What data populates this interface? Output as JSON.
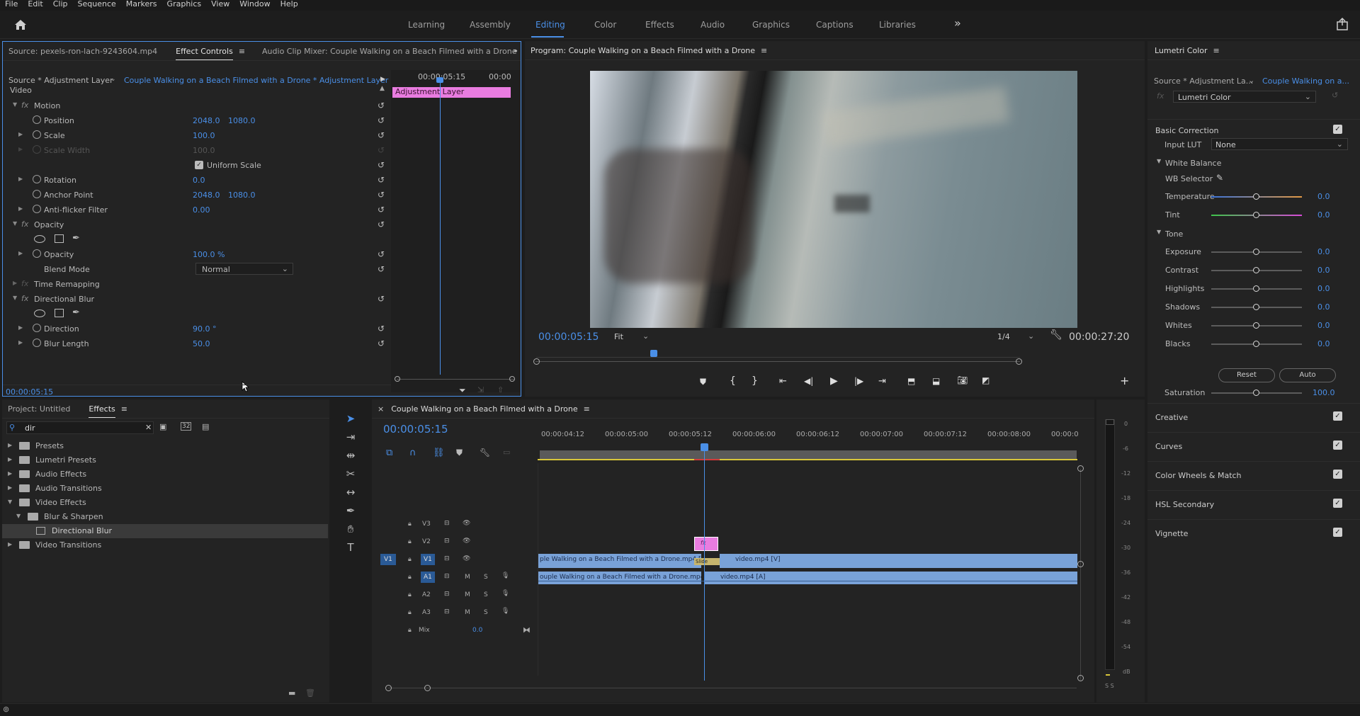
{
  "menu": [
    "File",
    "Edit",
    "Clip",
    "Sequence",
    "Markers",
    "Graphics",
    "View",
    "Window",
    "Help"
  ],
  "workspaces": {
    "tabs": [
      "Learning",
      "Assembly",
      "Editing",
      "Color",
      "Effects",
      "Audio",
      "Graphics",
      "Captions",
      "Libraries"
    ],
    "active": "Editing",
    "more": "»"
  },
  "effect_controls": {
    "tabs": [
      "Source: pexels-ron-lach-9243604.mp4",
      "Effect Controls",
      "Audio Clip Mixer: Couple Walking on a Beach Filmed with a Drone"
    ],
    "more": "»",
    "source_label": "Source * Adjustment Layer",
    "sequence_label": "Couple Walking on a Beach Filmed with a Drone * Adjustment Layer",
    "mini_tl_start": "00:00:05:15",
    "mini_tl_end": "00:00",
    "mini_clip": "Adjustment Layer",
    "section": "Video",
    "motion": "Motion",
    "position_label": "Position",
    "position_x": "2048.0",
    "position_y": "1080.0",
    "scale_label": "Scale",
    "scale_val": "100.0",
    "scalewidth_label": "Scale Width",
    "scalewidth_val": "100.0",
    "uniform_label": "Uniform Scale",
    "rotation_label": "Rotation",
    "rotation_val": "0.0",
    "anchor_label": "Anchor Point",
    "anchor_x": "2048.0",
    "anchor_y": "1080.0",
    "antiflicker_label": "Anti-flicker Filter",
    "antiflicker_val": "0.00",
    "opacity_group": "Opacity",
    "opacity_label": "Opacity",
    "opacity_val": "100.0 %",
    "blend_label": "Blend Mode",
    "blend_val": "Normal",
    "timeremap": "Time Remapping",
    "dirblur": "Directional Blur",
    "direction_label": "Direction",
    "direction_val": "90.0 °",
    "blurlen_label": "Blur Length",
    "blurlen_val": "50.0",
    "timecode": "00:00:05:15"
  },
  "program": {
    "title": "Program: Couple Walking on a Beach Filmed with a Drone",
    "timecode": "00:00:05:15",
    "fit": "Fit",
    "resolution": "1/4",
    "duration": "00:00:27:20"
  },
  "lumetri": {
    "title": "Lumetri Color",
    "source": "Source * Adjustment La...",
    "sequence": "Couple Walking on a...",
    "effect": "Lumetri Color",
    "basic": "Basic Correction",
    "input_lut_label": "Input LUT",
    "input_lut_val": "None",
    "white_balance": "White Balance",
    "wb_selector": "WB Selector",
    "temperature": {
      "label": "Temperature",
      "val": "0.0"
    },
    "tint": {
      "label": "Tint",
      "val": "0.0"
    },
    "tone": "Tone",
    "exposure": {
      "label": "Exposure",
      "val": "0.0"
    },
    "contrast": {
      "label": "Contrast",
      "val": "0.0"
    },
    "highlights": {
      "label": "Highlights",
      "val": "0.0"
    },
    "shadows": {
      "label": "Shadows",
      "val": "0.0"
    },
    "whites": {
      "label": "Whites",
      "val": "0.0"
    },
    "blacks": {
      "label": "Blacks",
      "val": "0.0"
    },
    "reset": "Reset",
    "auto": "Auto",
    "saturation": {
      "label": "Saturation",
      "val": "100.0"
    },
    "sections": [
      "Creative",
      "Curves",
      "Color Wheels & Match",
      "HSL Secondary",
      "Vignette"
    ]
  },
  "project": {
    "tabs": [
      "Project: Untitled",
      "Effects"
    ],
    "search": "dir",
    "tree": [
      "Presets",
      "Lumetri Presets",
      "Audio Effects",
      "Audio Transitions",
      "Video Effects",
      "Blur & Sharpen",
      "Directional Blur",
      "Video Transitions"
    ]
  },
  "timeline": {
    "title": "Couple Walking on a Beach Filmed with a Drone",
    "timecode": "00:00:05:15",
    "ruler": [
      "00:00:04:12",
      "00:00:05:00",
      "00:00:05:12",
      "00:00:06:00",
      "00:00:06:12",
      "00:00:07:00",
      "00:00:07:12",
      "00:00:08:00",
      "00:00:0"
    ],
    "tracks": [
      "V3",
      "V2",
      "V1",
      "A1",
      "A2",
      "A3"
    ],
    "source_v": "V1",
    "source_a": "A1",
    "mix_label": "Mix",
    "mix_val": "0.0",
    "clip_v1_a": "ple Walking on a Beach Filmed with a Drone.mp4 [V]",
    "clip_v1_b": "video.mp4 [V]",
    "clip_a1_a": "ouple Walking on a Beach Filmed with a Drone.mp4 [A]",
    "clip_a1_b": "video.mp4 [A]",
    "slide": "Slide",
    "fx": "fx",
    "ms": [
      "M",
      "S"
    ]
  },
  "meter": {
    "ticks": [
      "0",
      "-6",
      "-12",
      "-18",
      "-24",
      "-30",
      "-36",
      "-42",
      "-48",
      "-54",
      "dB"
    ],
    "bottom": "S S"
  }
}
